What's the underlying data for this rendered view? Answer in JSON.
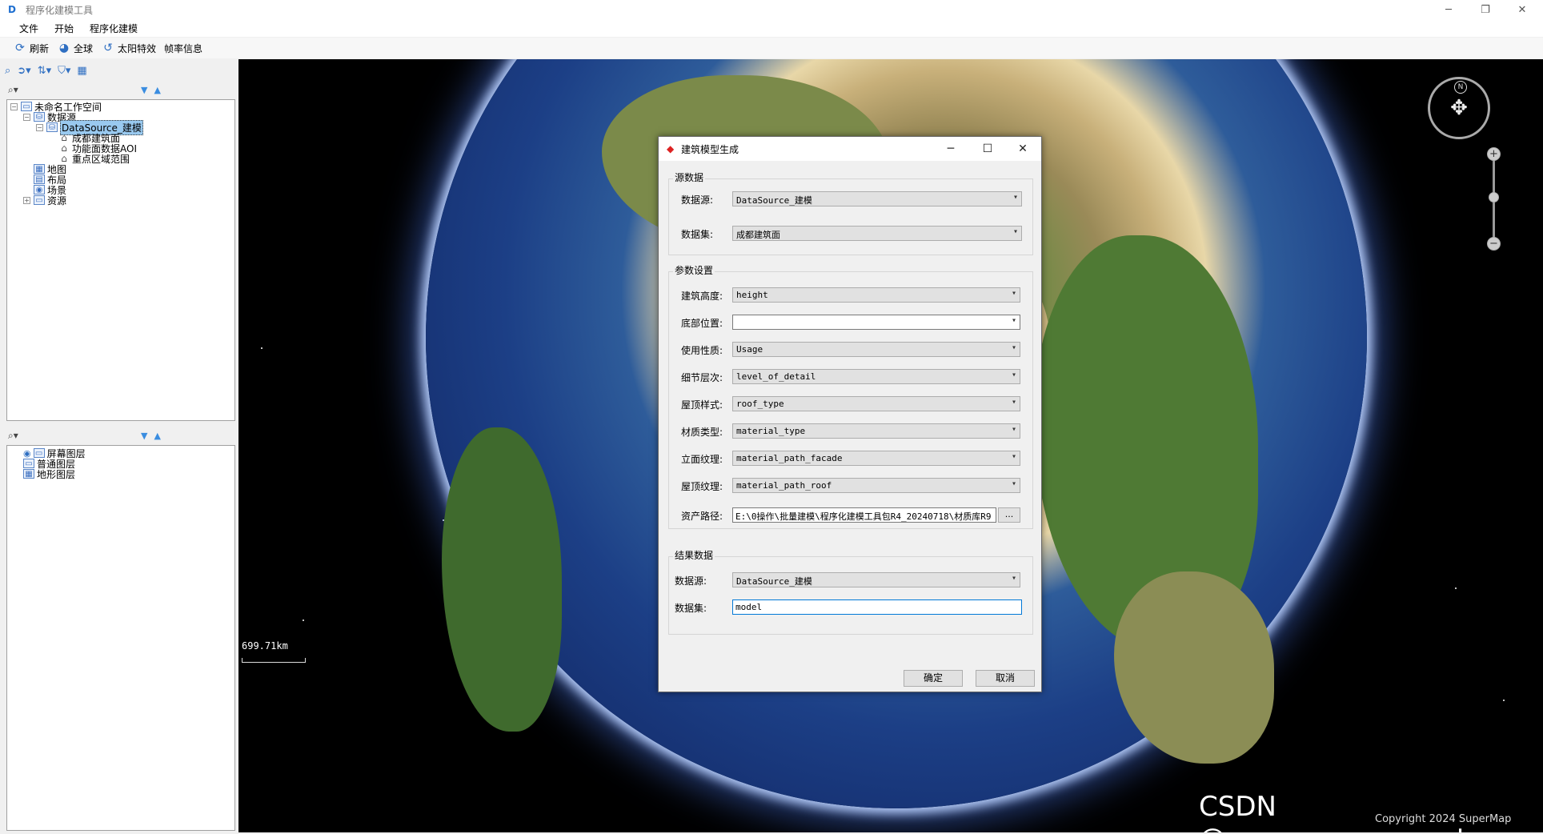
{
  "app": {
    "title": "程序化建模工具",
    "icon": "D"
  },
  "window_controls": {
    "minimize": "─",
    "restore": "❐",
    "close": "✕"
  },
  "menu": [
    "文件",
    "开始",
    "程序化建模"
  ],
  "toolbar": [
    {
      "icon": "refresh-icon",
      "label": "刷新",
      "glyph": "⟳"
    },
    {
      "icon": "globe-icon",
      "label": "全球",
      "glyph": "◕"
    },
    {
      "icon": "sun-icon",
      "label": "太阳特效",
      "glyph": "↺"
    },
    {
      "icon": "",
      "label": "帧率信息",
      "glyph": ""
    }
  ],
  "workspace_tree": {
    "root": "未命名工作空间",
    "datasources": "数据源",
    "datasource": "DataSource_建模",
    "datasets": [
      "成都建筑面",
      "功能面数据AOI",
      "重点区域范围"
    ],
    "others": [
      "地图",
      "布局",
      "场景",
      "资源"
    ]
  },
  "layer_tree": [
    "屏幕图层",
    "普通图层",
    "地形图层"
  ],
  "scene": {
    "scale_text": "699.71km",
    "watermark": "CSDN @supermapsupport",
    "copyright": "Copyright 2024 SuperMap",
    "compass_north": "N"
  },
  "dialog": {
    "title": "建筑模型生成",
    "source_group": "源数据",
    "source_datasource_label": "数据源:",
    "source_datasource_value": "DataSource_建模",
    "source_dataset_label": "数据集:",
    "source_dataset_value": "成都建筑面",
    "param_group": "参数设置",
    "params": [
      {
        "label": "建筑高度:",
        "value": "height"
      },
      {
        "label": "底部位置:",
        "value": ""
      },
      {
        "label": "使用性质:",
        "value": "Usage"
      },
      {
        "label": "细节层次:",
        "value": "level_of_detail"
      },
      {
        "label": "屋顶样式:",
        "value": "roof_type"
      },
      {
        "label": "材质类型:",
        "value": "material_type"
      },
      {
        "label": "立面纹理:",
        "value": "material_path_facade"
      },
      {
        "label": "屋顶纹理:",
        "value": "material_path_roof"
      }
    ],
    "asset_label": "资产路径:",
    "asset_value": "E:\\0操作\\批量建模\\程序化建模工具包R4_20240718\\材质库R9",
    "browse": "...",
    "result_group": "结果数据",
    "result_datasource_label": "数据源:",
    "result_datasource_value": "DataSource_建模",
    "result_dataset_label": "数据集:",
    "result_dataset_value": "model",
    "ok": "确定",
    "cancel": "取消"
  }
}
